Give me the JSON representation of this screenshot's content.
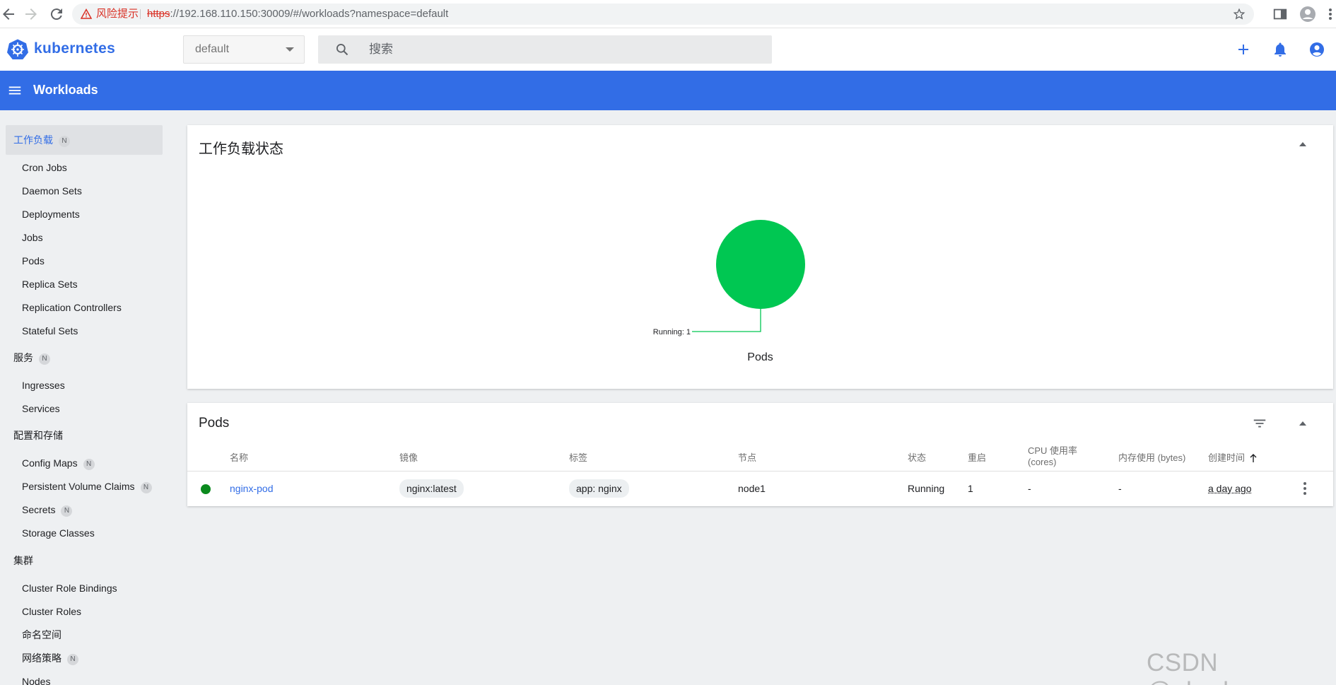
{
  "browser": {
    "security_warning": "风险提示",
    "url_scheme": "https",
    "url_rest": "://192.168.110.150:30009/#/workloads?namespace=default"
  },
  "header": {
    "logo_text": "kubernetes",
    "namespace_value": "default",
    "search_placeholder": "搜索"
  },
  "toolbar": {
    "title": "Workloads"
  },
  "sidebar": {
    "badge": "N",
    "groups": [
      {
        "label": "工作负载",
        "items": [
          "Cron Jobs",
          "Daemon Sets",
          "Deployments",
          "Jobs",
          "Pods",
          "Replica Sets",
          "Replication Controllers",
          "Stateful Sets"
        ]
      },
      {
        "label": "服务",
        "items": [
          "Ingresses",
          "Services"
        ]
      },
      {
        "label": "配置和存储",
        "items": [
          "Config Maps",
          "Persistent Volume Claims",
          "Secrets",
          "Storage Classes"
        ]
      },
      {
        "label": "集群",
        "items": [
          "Cluster Role Bindings",
          "Cluster Roles",
          "命名空间",
          "网络策略",
          "Nodes"
        ]
      }
    ]
  },
  "workload_status": {
    "title": "工作负载状态",
    "chart_label": "Pods"
  },
  "chart_data": {
    "type": "pie",
    "title": "Pods",
    "slices": [
      {
        "label": "Running",
        "value": 1,
        "color": "#00c752"
      }
    ]
  },
  "pods": {
    "title": "Pods",
    "columns": {
      "name": "名称",
      "image": "镜像",
      "labels": "标签",
      "node": "节点",
      "status": "状态",
      "restarts": "重启",
      "cpu_line1": "CPU 使用率",
      "cpu_line2": "(cores)",
      "memory": "内存使用 (bytes)",
      "created": "创建时间"
    },
    "rows": [
      {
        "name": "nginx-pod",
        "image": "nginx:latest",
        "label": "app: nginx",
        "node": "node1",
        "status": "Running",
        "restarts": "1",
        "cpu": "-",
        "memory": "-",
        "created": "a day ago"
      }
    ]
  },
  "colors": {
    "brand": "#326de6",
    "running": "#00c752",
    "status_dot": "#0b8a1e"
  },
  "watermark": "CSDN @aherhuo"
}
